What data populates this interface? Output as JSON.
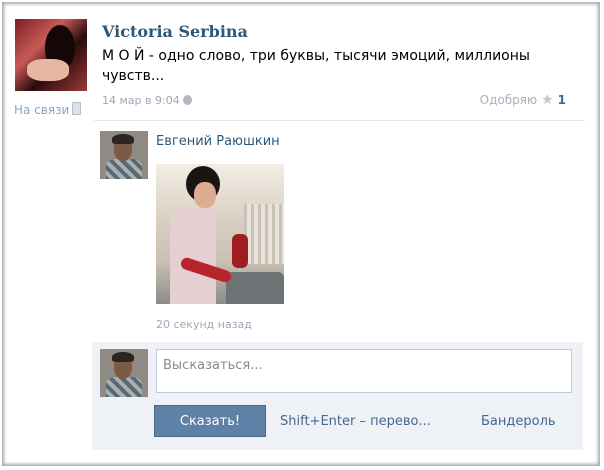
{
  "post": {
    "author": "Victoria Serbina",
    "text": "М О Й - одно слово, три буквы, тысячи эмоций, миллионы чувств...",
    "time": "14 мар в 9:04",
    "online_status": "На связи",
    "like_label": "Одобряю",
    "like_count": "1"
  },
  "comment": {
    "author": "Евгений Раюшкин",
    "time": "20 секунд назад"
  },
  "reply": {
    "placeholder": "Высказаться...",
    "send_label": "Сказать!",
    "hint": "Shift+Enter – перево...",
    "extra_label": "Бандероль"
  },
  "colors": {
    "link": "#2b587a",
    "button": "#5f81a7",
    "meta": "#9da9b8",
    "panel": "#eef1f5"
  },
  "icons": [
    "mobile-phone-icon",
    "apple-icon",
    "star-icon"
  ]
}
